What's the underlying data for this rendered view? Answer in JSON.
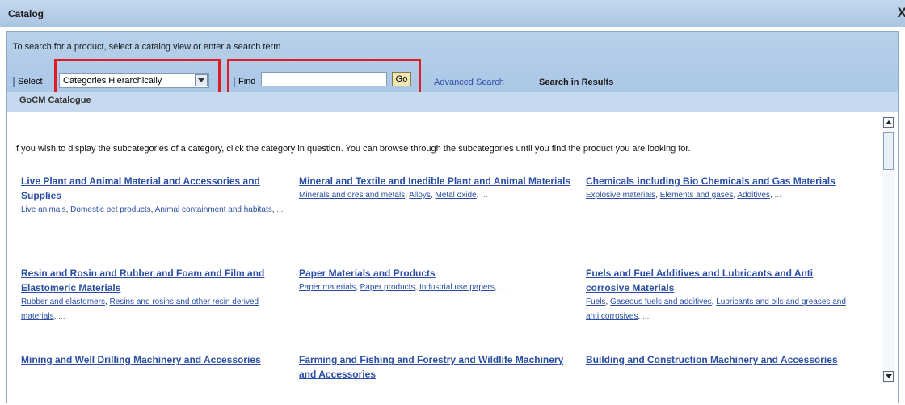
{
  "window": {
    "title": "Catalog",
    "close_glyph": "X"
  },
  "toolbar": {
    "instruction": "To search for a product, select a catalog view or enter a search term",
    "select_label": "Select",
    "dropdown_value": "Categories Hierarchically",
    "find_label": "Find",
    "find_value": "",
    "go_label": "Go",
    "advanced_search": "Advanced Search",
    "search_in_results": "Search in Results",
    "catalog_name": "GoCM Catalogue",
    "highlight_color": "#e01b22"
  },
  "content": {
    "intro": "If you wish to display the subcategories of a category, click the category in question. You can browse through the subcategories until you find the product you are looking for.",
    "categories": [
      {
        "title": "Live Plant and Animal Material and Accessories and Supplies",
        "links": [
          "Live animals",
          "Domestic pet products",
          "Animal containment and habitats"
        ]
      },
      {
        "title": "Mineral and Textile and Inedible Plant and Animal Materials",
        "links": [
          "Minerals and ores and metals",
          "Alloys",
          "Metal oxide"
        ]
      },
      {
        "title": "Chemicals including Bio Chemicals and Gas Materials",
        "links": [
          "Explosive materials",
          "Elements and gases",
          "Additives"
        ]
      },
      {
        "title": "Resin and Rosin and Rubber and Foam and Film and Elastomeric Materials",
        "links": [
          "Rubber and elastomers",
          "Resins and rosins and other resin derived materials"
        ]
      },
      {
        "title": "Paper Materials and Products",
        "links": [
          "Paper materials",
          "Paper products",
          "Industrial use papers"
        ]
      },
      {
        "title": "Fuels and Fuel Additives and Lubricants and Anti corrosive Materials",
        "links": [
          "Fuels",
          "Gaseous fuels and additives",
          "Lubricants and oils and greases and anti corrosives"
        ]
      },
      {
        "title": "Mining and Well Drilling Machinery and Accessories",
        "links": []
      },
      {
        "title": "Farming and Fishing and Forestry and Wildlife Machinery and Accessories",
        "links": []
      },
      {
        "title": "Building and Construction Machinery and Accessories",
        "links": []
      }
    ],
    "ellipsis": "..."
  }
}
